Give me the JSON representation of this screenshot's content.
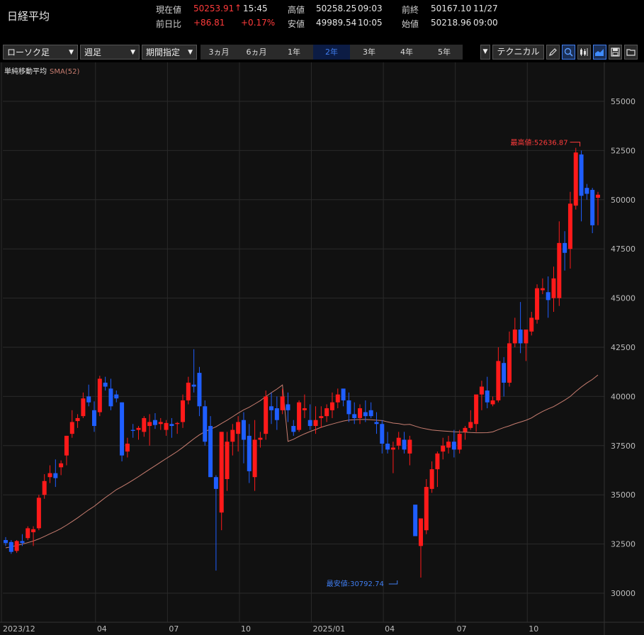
{
  "header": {
    "title": "日経平均",
    "current_label": "現在値",
    "current_value": "50253.91",
    "current_arrow": "↑",
    "current_time": "15:45",
    "change_label": "前日比",
    "change_value": "+86.81",
    "change_pct": "+0.17%",
    "high_label": "高値",
    "high_value": "50258.25",
    "high_time": "09:03",
    "low_label": "安値",
    "low_value": "49989.54",
    "low_time": "10:05",
    "prev_label": "前終",
    "prev_value": "50167.10",
    "prev_date": "11/27",
    "open_label": "始値",
    "open_value": "50218.96",
    "open_time": "09:00"
  },
  "toolbar": {
    "chart_type": "ローソク足",
    "period": "週足",
    "range_mode": "期間指定",
    "ranges": [
      "3ヵ月",
      "6ヵ月",
      "1年",
      "2年",
      "3年",
      "4年",
      "5年"
    ],
    "selected_range": "2年",
    "technical": "テクニカル"
  },
  "legend": {
    "label": "単純移動平均",
    "sma": "SMA(52)"
  },
  "colors": {
    "up": "#ff1a1a",
    "down": "#1f5eff",
    "sma": "#c87d70",
    "grid": "#2a2a2a",
    "background": "#111111"
  },
  "chart_data": {
    "type": "candlestick",
    "ylim": [
      29500,
      56500
    ],
    "y_ticks": [
      "30000",
      "32500",
      "35000",
      "37500",
      "40000",
      "42500",
      "45000",
      "47500",
      "50000",
      "52500",
      "55000"
    ],
    "x_labels": [
      "2023/12",
      "04",
      "07",
      "10",
      "2025/01",
      "04",
      "07",
      "10"
    ],
    "x_label_positions_index": [
      0,
      17,
      30,
      43,
      56,
      69,
      82,
      95
    ],
    "annotations": {
      "high": "最高値:52636.87",
      "high_index": 104,
      "high_value": 52636.87,
      "low": "最安値:30792.74",
      "low_index": 71,
      "low_value": 30792.74
    },
    "candles": [
      [
        32700,
        32850,
        32400,
        32550
      ],
      [
        32600,
        32700,
        32000,
        32100
      ],
      [
        32150,
        32700,
        32050,
        32650
      ],
      [
        32650,
        33000,
        32400,
        32550
      ],
      [
        32800,
        33400,
        32700,
        33300
      ],
      [
        33100,
        33400,
        32400,
        33250
      ],
      [
        33300,
        35000,
        33200,
        34850
      ],
      [
        35000,
        36050,
        34800,
        35700
      ],
      [
        35900,
        36500,
        35600,
        36100
      ],
      [
        36100,
        36800,
        35400,
        35850
      ],
      [
        36400,
        36750,
        36000,
        36600
      ],
      [
        37000,
        38000,
        36500,
        38000
      ],
      [
        38100,
        39300,
        37900,
        38700
      ],
      [
        38750,
        39100,
        38400,
        38900
      ],
      [
        39000,
        40200,
        38900,
        39900
      ],
      [
        40000,
        40600,
        39500,
        39700
      ],
      [
        39300,
        39750,
        38200,
        38500
      ],
      [
        39200,
        41050,
        39000,
        40900
      ],
      [
        40700,
        41000,
        40300,
        40500
      ],
      [
        40400,
        40900,
        39300,
        39500
      ],
      [
        40100,
        40300,
        39700,
        39900
      ],
      [
        39700,
        39700,
        36700,
        37000
      ],
      [
        37200,
        37900,
        36900,
        37600
      ],
      [
        38300,
        38600,
        37900,
        38250
      ],
      [
        38300,
        38500,
        37800,
        38400
      ],
      [
        38200,
        39000,
        37950,
        38900
      ],
      [
        38500,
        39100,
        37500,
        38700
      ],
      [
        38800,
        39150,
        38350,
        38550
      ],
      [
        38600,
        38900,
        38300,
        38700
      ],
      [
        38300,
        38800,
        38000,
        38650
      ],
      [
        38600,
        38900,
        37900,
        38500
      ],
      [
        38600,
        38700,
        38100,
        38650
      ],
      [
        38700,
        40100,
        38400,
        39800
      ],
      [
        39800,
        41000,
        39600,
        40700
      ],
      [
        40600,
        42400,
        40200,
        40500
      ],
      [
        41200,
        41500,
        39000,
        39500
      ],
      [
        39500,
        39800,
        37500,
        37700
      ],
      [
        38500,
        39000,
        35900,
        35900
      ],
      [
        35900,
        36000,
        31150,
        35300
      ],
      [
        34100,
        38200,
        33200,
        38200
      ],
      [
        35800,
        38200,
        35200,
        37700
      ],
      [
        37700,
        38600,
        37000,
        38300
      ],
      [
        38100,
        39000,
        37200,
        38700
      ],
      [
        38800,
        39200,
        36600,
        37800
      ],
      [
        38000,
        38600,
        35600,
        36200
      ],
      [
        35900,
        38800,
        35200,
        37800
      ],
      [
        37800,
        38200,
        37400,
        37900
      ],
      [
        38100,
        40300,
        37800,
        40000
      ],
      [
        39500,
        40200,
        38600,
        39300
      ],
      [
        39400,
        40000,
        38300,
        38800
      ],
      [
        39300,
        40400,
        39100,
        40000
      ],
      [
        39600,
        40200,
        38700,
        39300
      ],
      [
        38500,
        38800,
        38000,
        38200
      ],
      [
        38300,
        39800,
        38200,
        39700
      ],
      [
        39300,
        40100,
        38900,
        39400
      ],
      [
        38800,
        39600,
        38300,
        38500
      ],
      [
        38500,
        39500,
        38100,
        38800
      ],
      [
        38900,
        39500,
        38400,
        39000
      ],
      [
        39000,
        39600,
        38700,
        39400
      ],
      [
        39300,
        40200,
        38900,
        39700
      ],
      [
        39700,
        40400,
        39400,
        40100
      ],
      [
        40400,
        40300,
        39500,
        39800
      ],
      [
        39800,
        40200,
        38700,
        39100
      ],
      [
        39100,
        39700,
        38600,
        38900
      ],
      [
        38900,
        39600,
        38600,
        39400
      ],
      [
        39200,
        39800,
        38700,
        39000
      ],
      [
        39300,
        39700,
        38900,
        39000
      ],
      [
        38700,
        39200,
        38100,
        38600
      ],
      [
        38600,
        38800,
        37100,
        37600
      ],
      [
        37600,
        38200,
        37100,
        37300
      ],
      [
        37300,
        37700,
        36100,
        37400
      ],
      [
        37500,
        38200,
        37300,
        37900
      ],
      [
        37800,
        38200,
        37100,
        37300
      ],
      [
        37100,
        38000,
        36500,
        37800
      ],
      [
        34500,
        34500,
        32900,
        32900
      ],
      [
        32400,
        33800,
        30793,
        33800
      ],
      [
        33200,
        35800,
        33000,
        35400
      ],
      [
        35300,
        36700,
        35100,
        36300
      ],
      [
        36300,
        37200,
        35400,
        37100
      ],
      [
        37200,
        37900,
        36800,
        37500
      ],
      [
        37400,
        38000,
        37100,
        37700
      ],
      [
        37700,
        38300,
        36900,
        37300
      ],
      [
        37300,
        38300,
        37100,
        38100
      ],
      [
        38200,
        38500,
        37800,
        38400
      ],
      [
        38400,
        39300,
        38300,
        38700
      ],
      [
        38600,
        40000,
        38200,
        40100
      ],
      [
        40100,
        40800,
        39300,
        40500
      ],
      [
        40300,
        41000,
        39400,
        39700
      ],
      [
        39600,
        40000,
        39500,
        39800
      ],
      [
        39800,
        42500,
        39700,
        41800
      ],
      [
        41700,
        42000,
        40000,
        40700
      ],
      [
        40700,
        43300,
        40500,
        42700
      ],
      [
        42700,
        44000,
        42500,
        43400
      ],
      [
        43400,
        44800,
        42200,
        42700
      ],
      [
        42700,
        43400,
        41800,
        43400
      ],
      [
        43300,
        44300,
        43100,
        44000
      ],
      [
        43900,
        45700,
        43700,
        45500
      ],
      [
        45400,
        46000,
        45200,
        45500
      ],
      [
        45300,
        46100,
        44000,
        44900
      ],
      [
        45000,
        46600,
        44300,
        46000
      ],
      [
        45000,
        48900,
        44600,
        47800
      ],
      [
        47800,
        48400,
        46400,
        47300
      ],
      [
        47500,
        50400,
        46500,
        49800
      ],
      [
        49700,
        52637,
        49500,
        52400
      ],
      [
        52300,
        52500,
        48900,
        50200
      ],
      [
        50600,
        50800,
        50000,
        50300
      ],
      [
        50500,
        50600,
        48300,
        48700
      ],
      [
        50100,
        50400,
        48700,
        50254
      ]
    ]
  }
}
